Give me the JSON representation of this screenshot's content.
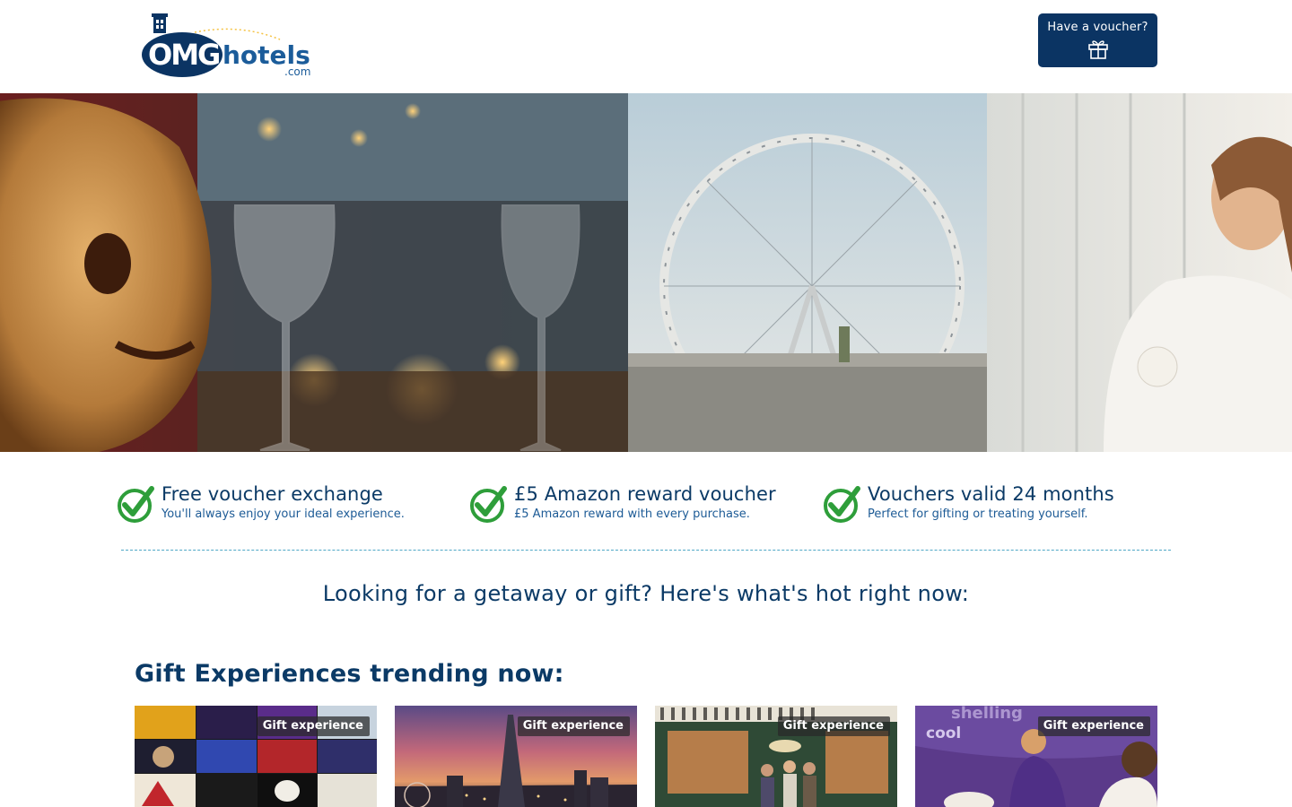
{
  "header": {
    "logo": {
      "brand_main": "OMG",
      "brand_rest": "hotels",
      "brand_suffix": ".com"
    },
    "voucher_button": {
      "label": "Have a voucher?",
      "icon": "gift-icon"
    }
  },
  "benefits": [
    {
      "icon": "check-icon",
      "title": "Free voucher exchange",
      "subtitle": "You'll always enjoy your ideal experience."
    },
    {
      "icon": "check-icon",
      "title": "£5 Amazon reward voucher",
      "subtitle": "£5 Amazon reward with every purchase."
    },
    {
      "icon": "check-icon",
      "title": "Vouchers valid 24 months",
      "subtitle": "Perfect for gifting or treating yourself."
    }
  ],
  "hot_heading": "Looking for a getaway or gift? Here's what's hot right now:",
  "trending": {
    "title": "Gift Experiences trending now:",
    "cards": [
      {
        "badge": "Gift experience",
        "image": "theatre-posters"
      },
      {
        "badge": "Gift experience",
        "image": "london-skyline-shard"
      },
      {
        "badge": "Gift experience",
        "image": "friends-central-perk"
      },
      {
        "badge": "Gift experience",
        "image": "chocolate-making"
      }
    ]
  },
  "colors": {
    "brand_navy": "#0b3463",
    "text_navy": "#0b3a66",
    "check_green": "#2e9e3a",
    "divider": "#4fa7c6"
  }
}
